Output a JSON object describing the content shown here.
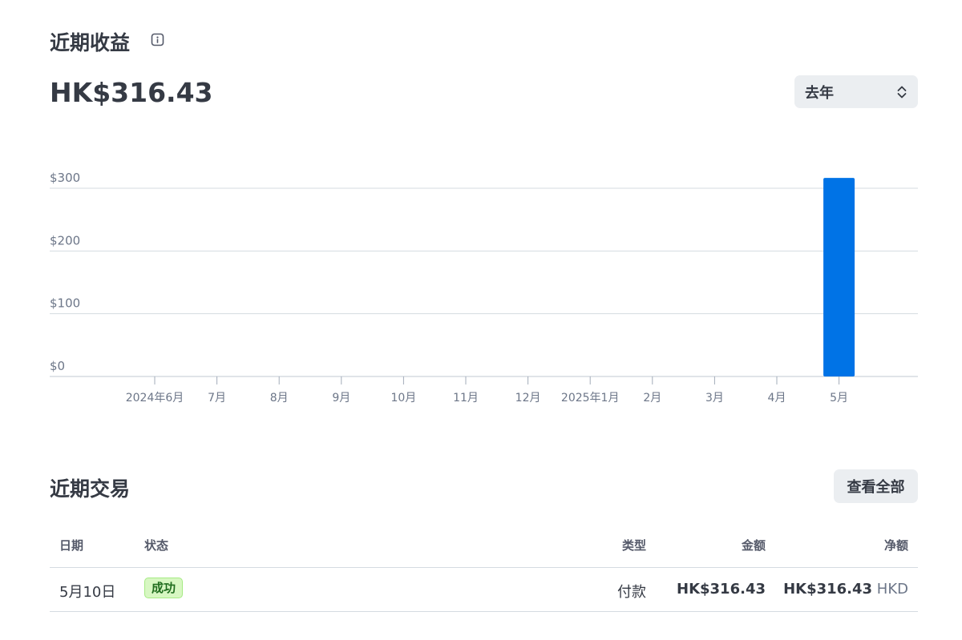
{
  "earnings": {
    "title": "近期收益",
    "info_icon": "info-icon",
    "total": "HK$316.43",
    "period_label": "去年",
    "period_icon": "chevron-up-down-icon"
  },
  "chart_data": {
    "type": "bar",
    "categories": [
      "2024年6月",
      "7月",
      "8月",
      "9月",
      "10月",
      "11月",
      "12月",
      "2025年1月",
      "2月",
      "3月",
      "4月",
      "5月"
    ],
    "values": [
      0,
      0,
      0,
      0,
      0,
      0,
      0,
      0,
      0,
      0,
      0,
      316.43
    ],
    "yticks": [
      "$0",
      "$100",
      "$200",
      "$300"
    ],
    "ytick_values": [
      0,
      100,
      200,
      300
    ],
    "ylim": [
      0,
      300
    ],
    "grid": true,
    "bar_color": "#0073e6",
    "title": "",
    "xlabel": "",
    "ylabel": ""
  },
  "transactions": {
    "title": "近期交易",
    "view_all_label": "查看全部",
    "headers": {
      "date": "日期",
      "status": "状态",
      "type": "类型",
      "amount": "金额",
      "net": "净额"
    },
    "rows": [
      {
        "date": "5月10日",
        "status": "成功",
        "type": "付款",
        "amount": "HK$316.43",
        "net": "HK$316.43",
        "currency": "HKD"
      }
    ]
  },
  "colors": {
    "accent": "#0073e6",
    "success_bg": "#d7f7c2",
    "success_text": "#216e1f",
    "button_bg": "#ebeef1"
  }
}
